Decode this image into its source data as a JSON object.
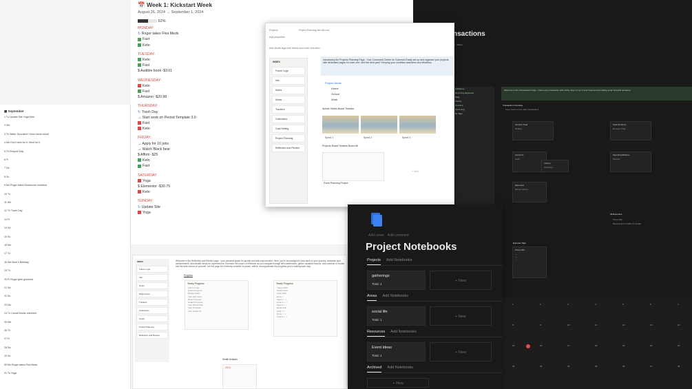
{
  "transactions": {
    "title": "nsactions",
    "callout": "Welcome to the Transactions Page - Track every transaction with clarity. Stay on top of your finances and making smart financial decisions.",
    "overview": "Transaction Overview",
    "overview_bullet": "Keep track of your daily transactions",
    "sidebar_items": [
      "Add/Move",
      "Recurring Expenses",
      "Daily",
      "Priority",
      "Overdue",
      "Upcoming",
      "By Tags"
    ],
    "blocks": [
      {
        "title": "Account Total",
        "sub": "Default"
      },
      {
        "title": "Total Numbers",
        "sub": "Remove Total"
      },
      {
        "title": "Accounts",
        "sub": "Cash"
      },
      {
        "title": "Income",
        "sub": "Checking"
      },
      {
        "title": "Spending Balance",
        "sub": "Savings"
      },
      {
        "title": "Expenses",
        "sub": "Money Savers"
      }
    ],
    "expense_tags_title": "Expense Tags",
    "expense_tag": "Phone Bill",
    "expense_list": [
      "Phone Bill",
      "Banana Drive Traffic for Kodak"
    ],
    "calendar_days": [
      "1",
      "2",
      "3",
      "4",
      "5",
      "6",
      "7",
      "8",
      "9",
      "10",
      "11",
      "12",
      "13",
      "14",
      "15",
      "16",
      "17",
      "18",
      "19",
      "20",
      "21",
      "22",
      "23",
      "24",
      "25",
      "26",
      "27",
      "28"
    ]
  },
  "week": {
    "title": "Week 1: Kickstart Week",
    "dates": "August 26, 2024 → September 1, 2024",
    "progress_label": "52%",
    "progress": 0.52,
    "days": [
      {
        "name": "MONDAY:",
        "items": [
          {
            "mark": "refresh",
            "text": "Roger takes Flea Meds"
          },
          {
            "mark": "green",
            "text": "Fast"
          },
          {
            "mark": "green",
            "text": "Keto"
          }
        ]
      },
      {
        "name": "TUESDAY:",
        "items": [
          {
            "mark": "green",
            "text": "Keto"
          },
          {
            "mark": "green",
            "text": "Fast"
          },
          {
            "mark": "none",
            "text": "$ Audible book -$3.01"
          }
        ]
      },
      {
        "name": "WEDNESDAY:",
        "items": [
          {
            "mark": "red",
            "text": "Keto"
          },
          {
            "mark": "green",
            "text": "Fast"
          },
          {
            "mark": "none",
            "text": "$ Amazon -$20.98"
          }
        ]
      },
      {
        "name": "THURSDAY:",
        "items": [
          {
            "mark": "refresh",
            "text": "Trash Day"
          },
          {
            "mark": "none",
            "text": "→ Start work on Period Template 3.0"
          },
          {
            "mark": "red",
            "text": "Fast"
          },
          {
            "mark": "red",
            "text": "Keto"
          }
        ]
      },
      {
        "name": "FRIDAY:",
        "items": [
          {
            "mark": "none",
            "text": "→ Apply for 10 jobs"
          },
          {
            "mark": "none",
            "text": "→ Watch Black bear"
          },
          {
            "mark": "none",
            "text": "$ Affirm -$25"
          },
          {
            "mark": "green",
            "text": "Keto"
          },
          {
            "mark": "green",
            "text": "Fast"
          }
        ]
      },
      {
        "name": "SATURDAY:",
        "items": [
          {
            "mark": "red",
            "text": "Yoga"
          },
          {
            "mark": "none",
            "text": "$ Elementor -$30.75"
          },
          {
            "mark": "red",
            "text": "Keto"
          }
        ]
      },
      {
        "name": "SUNDAY:",
        "items": [
          {
            "mark": "refresh",
            "text": "Update Site"
          },
          {
            "mark": "red",
            "text": "Yoga"
          }
        ]
      }
    ]
  },
  "planning": {
    "meta_1": "Projects",
    "meta_2": "Project Planning dev life.exe",
    "meta_3": "Add properties",
    "actions": "Add Month tags  Add Tables  Add Inner Sub-item",
    "toc_title": "INDEX",
    "toc": [
      "Future Logs",
      "Info",
      "Notes",
      "Areas",
      "Trackers",
      "Collections",
      "Goal Setting",
      "Project Planning",
      "Reflection and Review"
    ],
    "banner": "Introducing the Projects Planning Page - Your Command Center for Success! Easily set up and organize your projects with dedicated pages for each one. And the best part? Keeping your workflow seamless and effortless.",
    "areas_title": "Project Areas",
    "areas": [
      "Home",
      "School",
      "Work"
    ],
    "views": "Sprints  Tables  Board  Timeline",
    "sprints": [
      "Sprint 1",
      "Sprint 2",
      "Sprint 3"
    ],
    "views_2": "Projects  Board  Timeline  Board  All",
    "project_item": "Event Planning Project",
    "new": "+ New"
  },
  "september": {
    "title": "September",
    "rows": [
      "1 Tu  Update Site  Yoga  Keto",
      "2 We",
      "3 Th  Water Succulent  Clean mens closet",
      "4 We  Don't wish for it. Work for it",
      "5 Th  Recycle Day",
      "6 Fr",
      "7 Sa",
      "8 Su",
      "9 Mo  Roger takes Heartworm medicine",
      "10 Tu",
      "11 We",
      "12 Th  Trash Day",
      "13 Fr",
      "14 Sa",
      "15 Su",
      "16 Mo",
      "17 Tu",
      "18 We  Mom's Birthday",
      "19 Th",
      "20 Fr  Roger gets groomed",
      "21 Sa",
      "22 Su",
      "23 Mo",
      "24 Tu  Cancel kindle unlimited",
      "25 We",
      "26 Th",
      "27 Fr",
      "28 Sa",
      "29 Su",
      "30 Mo  Roger takes Flea Meds",
      "31 Tu  Yoga"
    ]
  },
  "reflection": {
    "toc_title": "INDEX",
    "toc": [
      "Future Logs",
      "Info",
      "Notes",
      "Daily Focus",
      "Trackers",
      "Collections",
      "Goals",
      "Project Planning",
      "Reflection and Review"
    ],
    "intro": "Welcome to the Reflection and Review page - your personal space for growth and self-improvement. Here, you're encouraged to look back on your journey, celebrate your achievements, and identify areas for improvement. Embrace the power of reflection as you navigate through life's adventures, gather valuable lessons, and continue to evolve into the best version of yourself. Let this page be a friendly reminder to pause, reflect, and appreciate the progress you're making each day!",
    "progress_label": "Progress",
    "card1_title": "Yearly Progress",
    "card1_sub": "Future Logs",
    "card1_lines": [
      "Goals Progress",
      "Budget 2024",
      "Year with Pixel",
      "Book Progress",
      "Health Progress",
      "Year Month Plan",
      "Year Progress",
      "Year Goals 24"
    ],
    "card2_title": "Yearly Progress",
    "card2_sub": "Yearly 2024",
    "card2_lines": [
      "Goals Done",
      "Goal 2024",
      "Done ✓",
      "Spent ✓ ✓",
      "Goal 4 ✓ ✓",
      "Saved ✓ ✓",
      "Read 2/10",
      "Goal 7 ✓",
      "Done ✓ ✓",
      "Goal 9 ✓ ✓"
    ],
    "health_title": "Health Analysis",
    "health_year": "2024"
  },
  "notebooks": {
    "add_cover": "Add cover",
    "add_comment": "Add comment",
    "title": "Project Notebooks",
    "sections": [
      {
        "tab": "Projects",
        "add": "Add Notebooks",
        "card": "gatherings",
        "total": "Total: 1"
      },
      {
        "tab": "Areas",
        "add": "Add Notebooks",
        "card": "social life",
        "total": "Total: 1"
      },
      {
        "tab": "Resources",
        "add": "Add Notebooks",
        "card": "Event Ideas",
        "total": "Total: 1"
      },
      {
        "tab": "Archived",
        "add": "Add Notebooks",
        "card": "",
        "total": ""
      }
    ],
    "new": "+ New",
    "accent": "#2f6fdc"
  }
}
